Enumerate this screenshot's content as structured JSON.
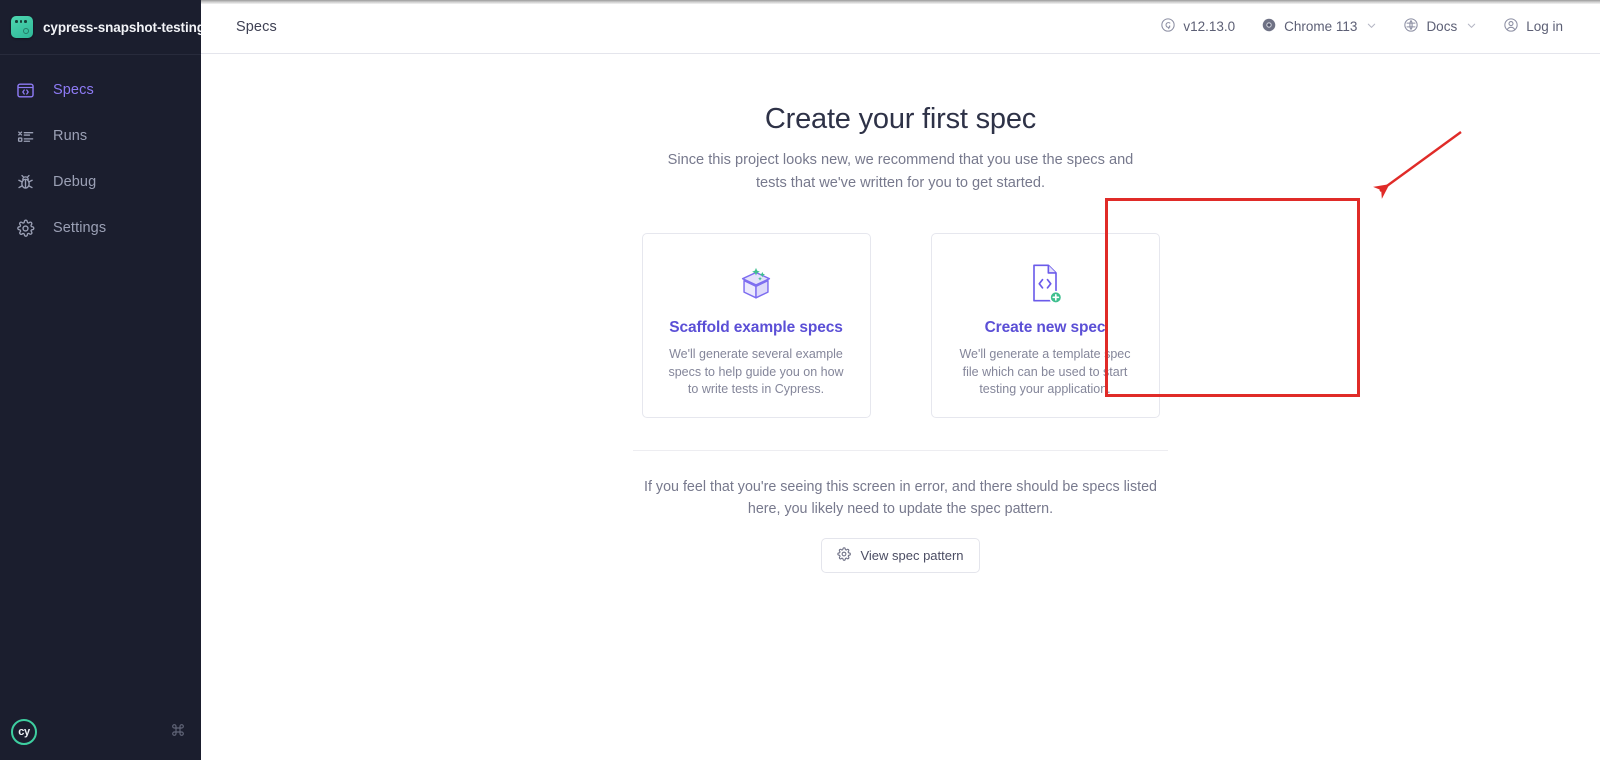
{
  "sidebar": {
    "project": {
      "name": "cypress-snapshot-testing",
      "icon": "project-square-icon"
    },
    "items": [
      {
        "label": "Specs",
        "icon": "specs-window-code-icon",
        "active": true
      },
      {
        "label": "Runs",
        "icon": "runs-list-icon",
        "active": false
      },
      {
        "label": "Debug",
        "icon": "bug-icon",
        "active": false
      },
      {
        "label": "Settings",
        "icon": "gear-icon",
        "active": false
      }
    ],
    "footer": {
      "logo_label": "cy",
      "logo_icon": "cypress-logo-icon",
      "shortcut_icon": "command-key-icon",
      "shortcut_glyph": "⌘"
    }
  },
  "header": {
    "title": "Specs",
    "right_items": [
      {
        "label": "v12.13.0",
        "icon": "cypress-version-icon",
        "caret": false
      },
      {
        "label": "Chrome 113",
        "icon": "chrome-browser-icon",
        "caret": true
      },
      {
        "label": "Docs",
        "icon": "docs-book-icon",
        "caret": true
      },
      {
        "label": "Log in",
        "icon": "user-avatar-icon",
        "caret": false
      }
    ],
    "caret_glyph": "⌄"
  },
  "main": {
    "heading": "Create your first spec",
    "subtitle": "Since this project looks new, we recommend that you use the specs and tests that we've written for you to get started.",
    "cards": [
      {
        "title": "Scaffold example specs",
        "description": "We'll generate several example specs to help guide you on how to write tests in Cypress.",
        "icon": "open-box-sparkles-icon"
      },
      {
        "title": "Create new spec",
        "description": "We'll generate a template spec file which can be used to start testing your application.",
        "icon": "code-file-plus-icon"
      }
    ],
    "footnote": "If you feel that you're seeing this screen in error, and there should be specs listed here, you likely need to update the spec pattern.",
    "spec_pattern_button": {
      "label": "View spec pattern",
      "icon": "gear-icon"
    }
  },
  "annotation": {
    "highlight_color": "#e02b28",
    "arrow_icon": "red-arrow-pointer",
    "target": "Create new spec"
  },
  "colors": {
    "sidebar_bg": "#1b1e2e",
    "accent_purple": "#5b4fd6",
    "active_nav": "#8e7bf5",
    "teal": "#3ecfa0",
    "annotation_red": "#e02b28"
  }
}
